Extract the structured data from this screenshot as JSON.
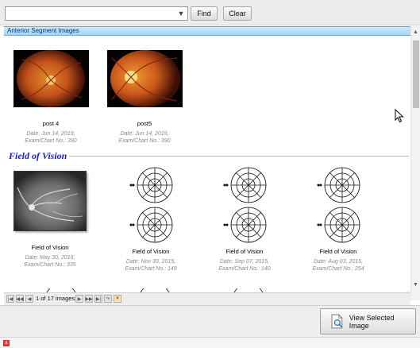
{
  "toolbar": {
    "search_value": "",
    "find_label": "Find",
    "clear_label": "Clear"
  },
  "anterior": {
    "title": "Anterior Segment Images",
    "images": [
      {
        "caption": "post 4",
        "date": "Date: Jun 14, 2019,",
        "exam": "Exam/Chart No.: 390"
      },
      {
        "caption": "post5",
        "date": "Date: Jun 14, 2019,",
        "exam": "Exam/Chart No.: 390"
      }
    ]
  },
  "field_of_vision": {
    "title": "Field of Vision",
    "images": [
      {
        "caption": "Field of Vision",
        "date": "Date: May 30, 2016,",
        "exam": "Exam/Chart No.: 335"
      },
      {
        "caption": "Field of Vision",
        "date": "Date: Nov 30, 2015,",
        "exam": "Exam/Chart No.: 149"
      },
      {
        "caption": "Field of Vision",
        "date": "Date: Sep 07, 2015,",
        "exam": "Exam/Chart No.: 140"
      },
      {
        "caption": "Field of Vision",
        "date": "Date: Aug 03, 2015,",
        "exam": "Exam/Chart No.: 254"
      }
    ]
  },
  "pager": {
    "text": "1 of 17 images",
    "icons": [
      "first-page-icon",
      "prev-page-icon",
      "next-page-icon",
      "fast-forward-icon",
      "last-page-icon",
      "refresh-icon",
      "filter-icon"
    ]
  },
  "actions": {
    "view_selected_label": "View Selected Image"
  },
  "colors": {
    "section_title": "#1a1ae0",
    "section_bar": "#a7d3ef",
    "close": "#e03030"
  }
}
